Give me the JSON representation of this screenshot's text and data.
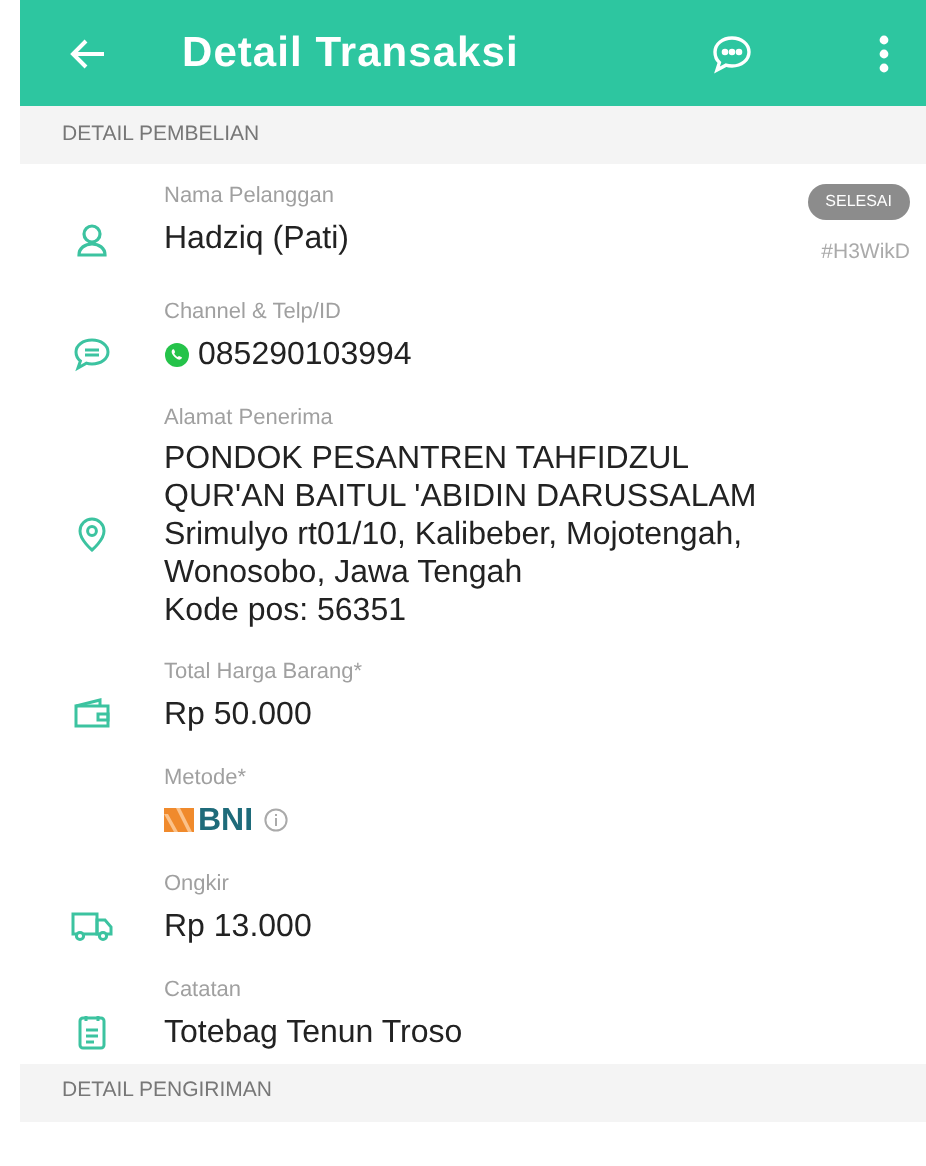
{
  "app_bar": {
    "title": "Detail Transaksi"
  },
  "sections": [
    {
      "title": "DETAIL PEMBELIAN",
      "fields": [
        {
          "kind": "customer",
          "label": "Nama Pelanggan",
          "value": "Hadziq (Pati)",
          "status": "SELESAI",
          "code": "#H3WikD"
        },
        {
          "kind": "channel",
          "label": "Channel & Telp/ID",
          "value": "085290103994"
        },
        {
          "kind": "address",
          "label": "Alamat Penerima",
          "value": "PONDOK PESANTREN TAHFIDZUL\nQUR'AN BAITUL 'ABIDIN DARUSSALAM\nSrimulyo rt01/10, Kalibeber, Mojotengah,\nWonosobo, Jawa Tengah\nKode pos: 56351"
        },
        {
          "kind": "price",
          "label": "Total Harga Barang*",
          "value": "Rp 50.000"
        },
        {
          "kind": "payment",
          "label": "Metode*",
          "value": "BNI"
        },
        {
          "kind": "shipping",
          "label": "Ongkir",
          "value": "Rp 13.000"
        },
        {
          "kind": "note",
          "label": "Catatan",
          "value": "Totebag Tenun Troso"
        }
      ]
    },
    {
      "title": "DETAIL PENGIRIMAN"
    }
  ]
}
